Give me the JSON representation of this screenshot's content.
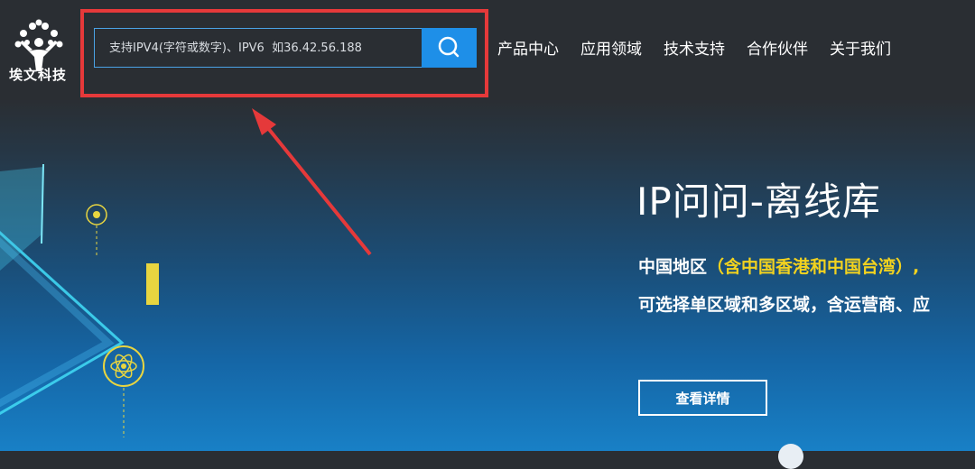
{
  "logo": {
    "text": "埃文科技"
  },
  "search": {
    "placeholder": "支持IPV4(字符或数字)、IPV6  如36.42.56.188",
    "button_icon": "search-icon"
  },
  "nav": {
    "items": [
      {
        "label": "产品中心"
      },
      {
        "label": "应用领域"
      },
      {
        "label": "技术支持"
      },
      {
        "label": "合作伙伴"
      },
      {
        "label": "关于我们"
      }
    ]
  },
  "hero": {
    "title": "IP问问-离线库",
    "line1_prefix": "中国地区",
    "line1_highlight": "（含中国香港和中国台湾）,",
    "line2": "可选择单区域和多区域，含运营商、应",
    "button_label": "查看详情"
  },
  "colors": {
    "annotation": "#e5393a",
    "accent": "#1e8fe8",
    "highlight_text": "#f2d21f"
  }
}
